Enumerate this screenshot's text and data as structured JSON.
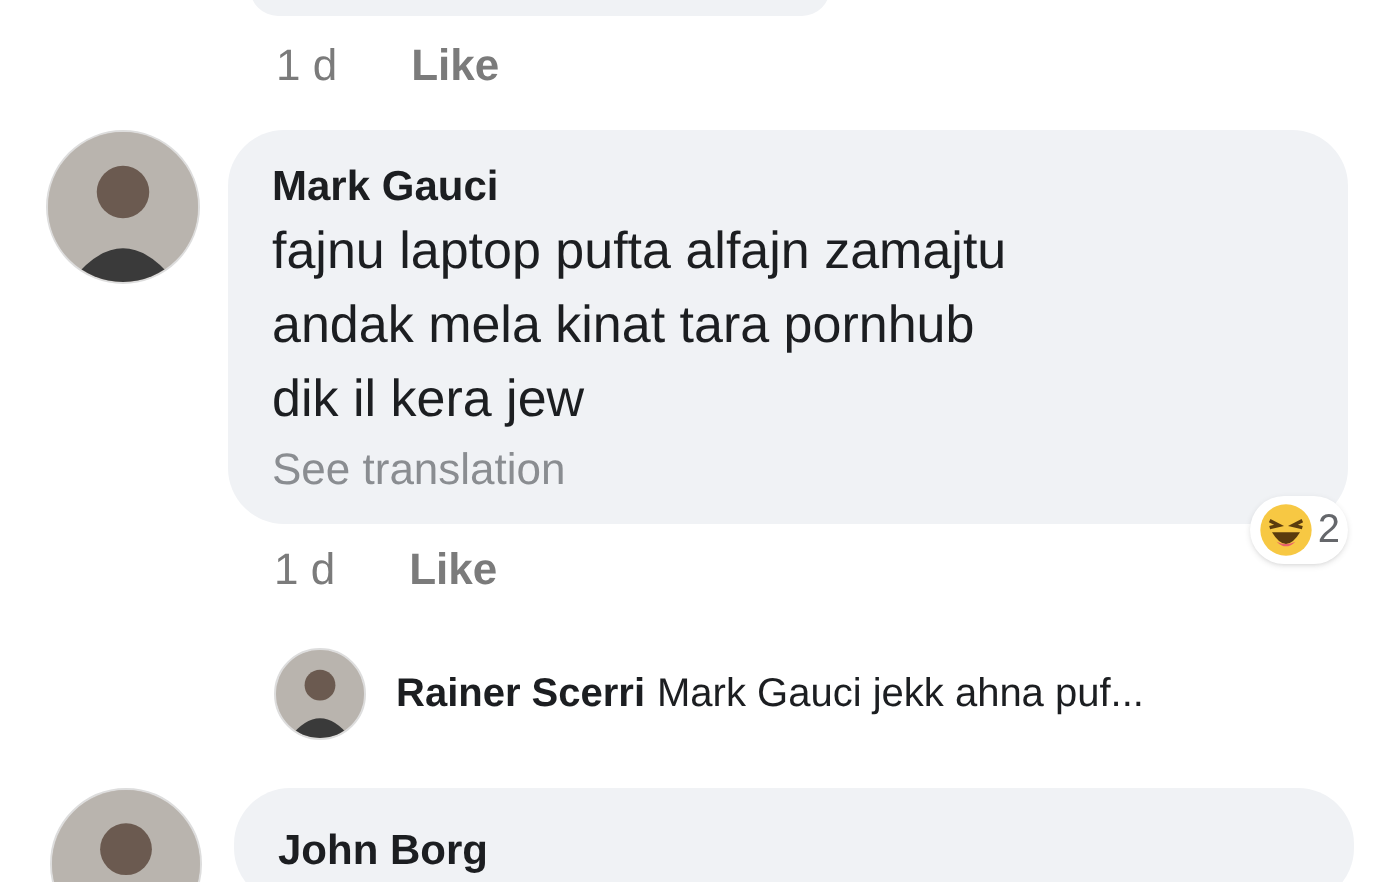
{
  "previous_comment": {
    "time": "1 d",
    "like": "Like"
  },
  "comment": {
    "author": "Mark Gauci",
    "text": "fajnu laptop pufta alfajn zamajtu andak mela kinat tara pornhub dik il kera jew",
    "translate": "See translation",
    "time": "1 d",
    "like": "Like",
    "reaction_count": "2"
  },
  "reply": {
    "author": "Rainer Scerri",
    "text": "Mark Gauci jekk ahna puf..."
  },
  "next_comment": {
    "author": "John Borg"
  }
}
